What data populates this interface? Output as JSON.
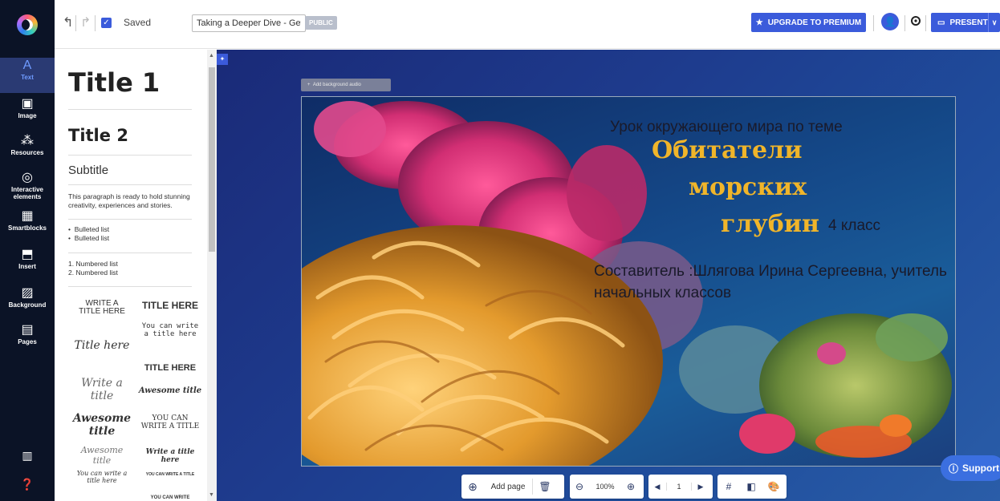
{
  "topbar": {
    "saved_label": "Saved",
    "presentation_title": "Taking a Deeper Dive - Get",
    "visibility_badge": "PUBLIC",
    "upgrade_label": "UPGRADE TO PREMIUM",
    "present_label": "PRESENT"
  },
  "sidebar": {
    "items": [
      {
        "label": "Text",
        "icon": "text-icon",
        "glyph": "A"
      },
      {
        "label": "Image",
        "icon": "image-icon",
        "glyph": "▣"
      },
      {
        "label": "Resources",
        "icon": "resources-icon",
        "glyph": "⁂"
      },
      {
        "label": "Interactive elements",
        "icon": "interactive-icon",
        "glyph": "◎"
      },
      {
        "label": "Smartblocks",
        "icon": "smartblocks-icon",
        "glyph": "▦"
      },
      {
        "label": "Insert",
        "icon": "insert-icon",
        "glyph": "⬒"
      },
      {
        "label": "Background",
        "icon": "background-icon",
        "glyph": "▨"
      },
      {
        "label": "Pages",
        "icon": "pages-icon",
        "glyph": "▤"
      }
    ]
  },
  "text_panel": {
    "title1": "Title 1",
    "title2": "Title 2",
    "subtitle": "Subtitle",
    "paragraph": "This paragraph is ready to hold stunning creativity, experiences and stories.",
    "bullets": [
      "Bulleted list",
      "Bulleted list"
    ],
    "numbers": [
      "1. Numbered list",
      "2. Numbered list"
    ],
    "templates": {
      "t1": "WRITE A TITLE HERE",
      "t2": "TITLE HERE",
      "t3": "You can write a title here",
      "t4": "Title here",
      "t5": "TITLE HERE",
      "t6": "Write a title",
      "t7": "Awesome title",
      "t8": "Awesome title",
      "t9": "YOU CAN WRITE A TITLE",
      "t10": "Awesome title",
      "t11": "Write a title here",
      "t12": "You can write a title here",
      "t13": "YOU CAN WRITE A TITLE",
      "t14": "YOU CAN WRITE"
    }
  },
  "canvas": {
    "audio_label": "Add background audio",
    "lesson_line": "Урок окружающего мира по теме",
    "title_line1": "Обитатели",
    "title_line2": "морских",
    "title_line3": "глубин",
    "grade": "4 класс",
    "author": "Составитель :Шлягова Ирина Сергеевна, учитель начальных классов"
  },
  "bottom_toolbar": {
    "add_page_label": "Add page",
    "zoom_level": "100%",
    "page_number": "1"
  },
  "support_label": "Support"
}
